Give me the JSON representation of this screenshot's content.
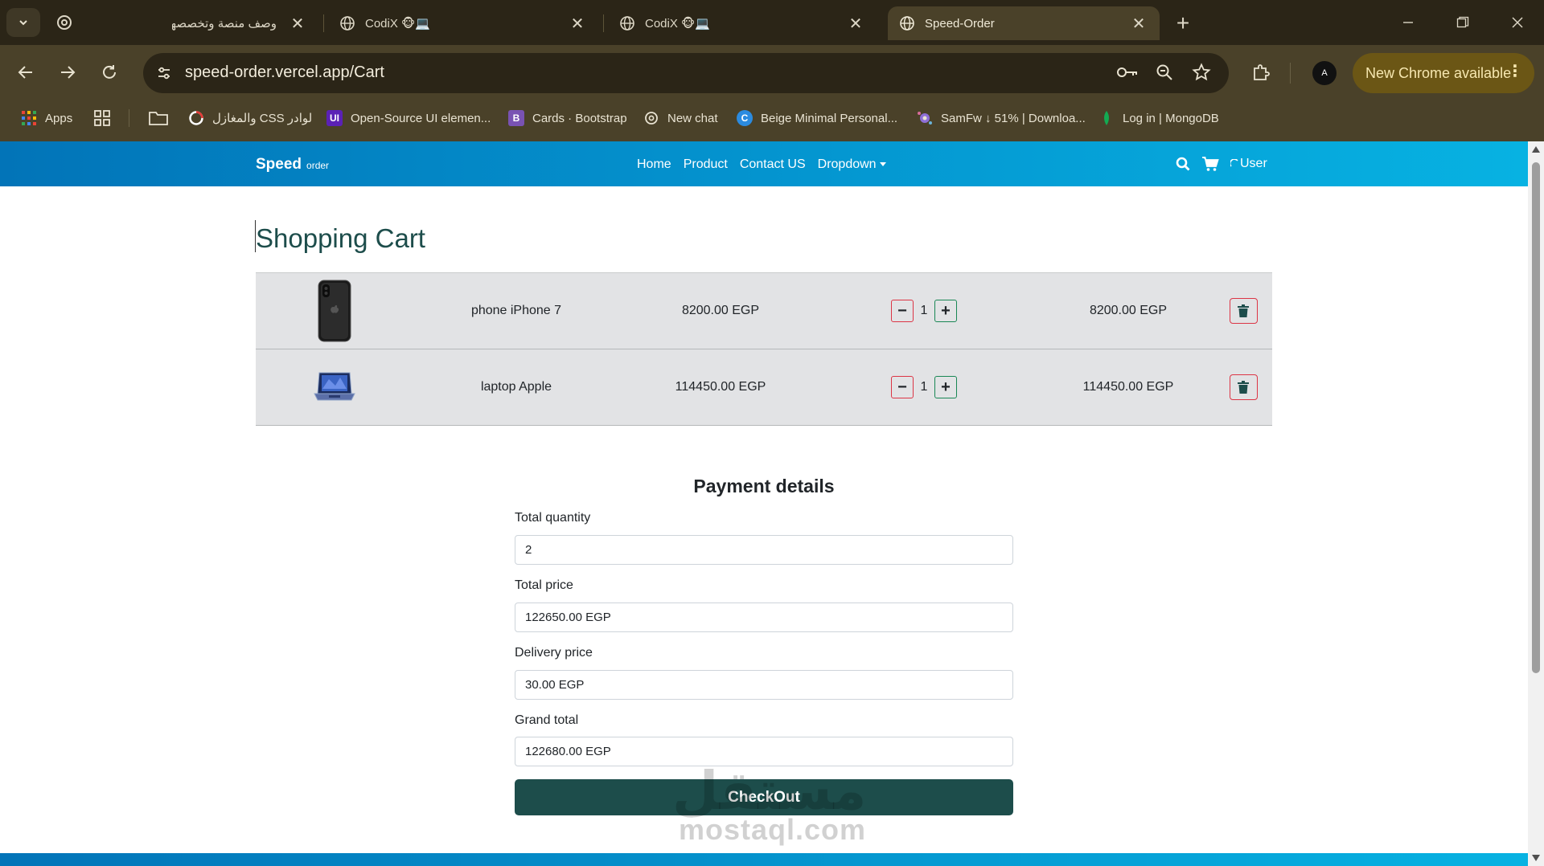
{
  "browser": {
    "tabs": [
      {
        "title": "وصف منصة وتخصصها",
        "active": false
      },
      {
        "title": "CodiX 🐵💻",
        "active": false
      },
      {
        "title": "CodiX 🐵💻",
        "active": false
      },
      {
        "title": "Speed-Order",
        "active": true
      }
    ],
    "address": "speed-order.vercel.app/Cart",
    "update_label": "New Chrome available",
    "profile_initials": "A",
    "bookmarks": [
      {
        "label": "Apps",
        "icon": "apps-grid-icon"
      },
      {
        "label": "لوادر CSS والمغازل",
        "icon": "loader-icon"
      },
      {
        "label": "Open-Source UI elemen...",
        "icon": "ui-icon"
      },
      {
        "label": "Cards · Bootstrap",
        "icon": "bootstrap-icon"
      },
      {
        "label": "New chat",
        "icon": "chatgpt-icon"
      },
      {
        "label": "Beige Minimal Personal...",
        "icon": "canva-icon"
      },
      {
        "label": "SamFw ↓ 51% | Downloa...",
        "icon": "samfw-icon"
      },
      {
        "label": "Log in | MongoDB",
        "icon": "mongodb-icon"
      }
    ]
  },
  "site": {
    "brand": "Speed",
    "brand_small": "order",
    "nav": [
      "Home",
      "Product",
      "Contact US",
      "Dropdown"
    ],
    "user_label": "User"
  },
  "cart": {
    "title": "Shopping Cart",
    "items": [
      {
        "name": "phone iPhone 7",
        "price": "8200.00 EGP",
        "qty": "1",
        "total": "8200.00 EGP",
        "image": "phone-image"
      },
      {
        "name": "laptop Apple",
        "price": "114450.00 EGP",
        "qty": "1",
        "total": "114450.00 EGP",
        "image": "laptop-image"
      }
    ]
  },
  "payment": {
    "title": "Payment details",
    "fields": [
      {
        "label": "Total quantity",
        "value": "2"
      },
      {
        "label": "Total price",
        "value": "122650.00 EGP"
      },
      {
        "label": "Delivery price",
        "value": "30.00 EGP"
      },
      {
        "label": "Grand total",
        "value": "122680.00 EGP"
      }
    ],
    "checkout_label": "CheckOut"
  },
  "watermark": {
    "arabic": "مستقل",
    "latin": "mostaql.com"
  },
  "colors": {
    "accent": "#1d4d4b",
    "nav_gradient_start": "#0274b8",
    "nav_gradient_end": "#07b2e2",
    "danger": "#dc3545",
    "success": "#198754"
  }
}
